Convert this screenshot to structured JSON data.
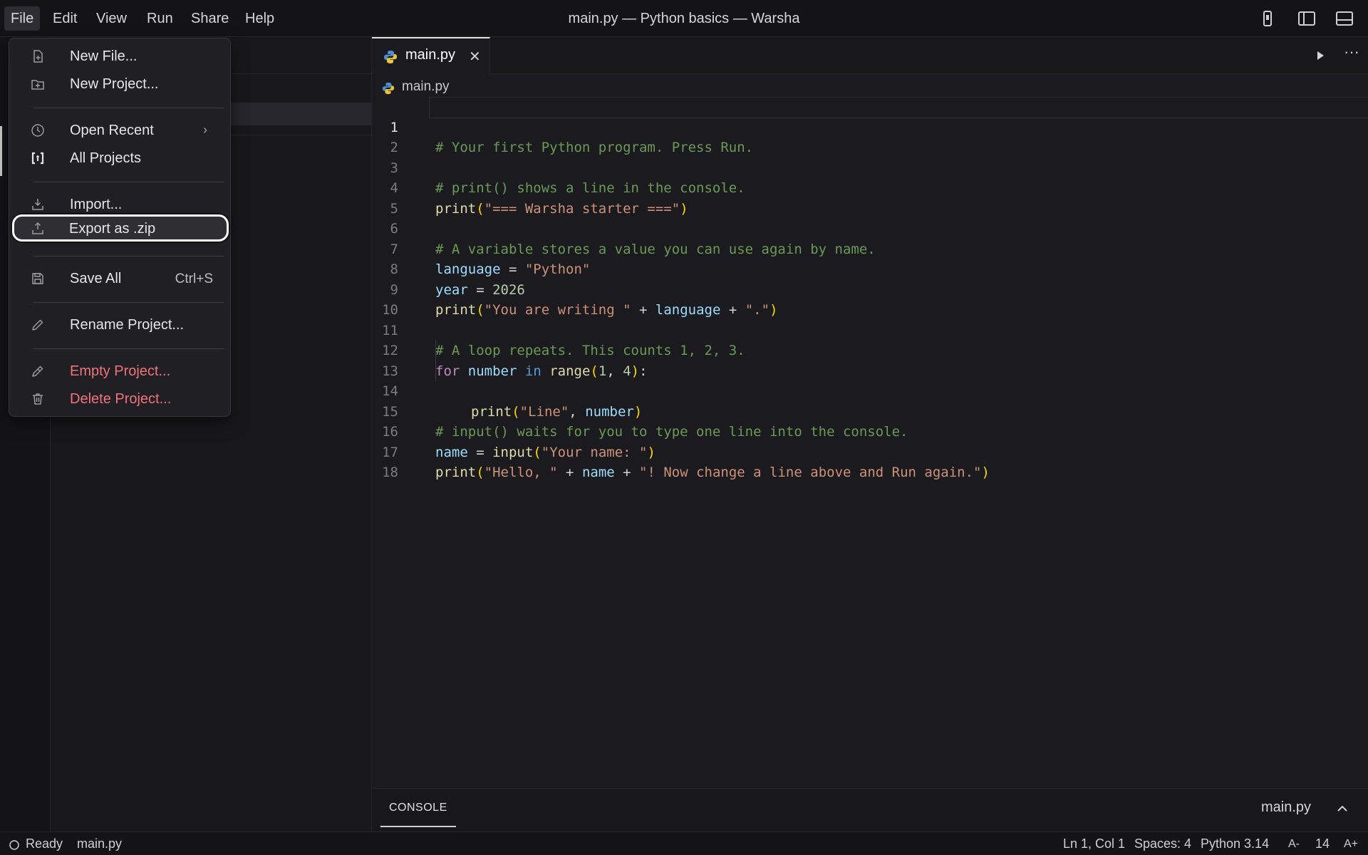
{
  "menubar": {
    "items": [
      "File",
      "Edit",
      "View",
      "Run",
      "Share",
      "Help"
    ],
    "window_title": "main.py — Python basics — Warsha"
  },
  "file_menu": {
    "new_file": "New File...",
    "new_project": "New Project...",
    "open_recent": "Open Recent",
    "all_projects": "All Projects",
    "import": "Import...",
    "export_zip": "Export as .zip",
    "save_all": "Save All",
    "save_all_shortcut": "Ctrl+S",
    "rename_project": "Rename Project...",
    "empty_project": "Empty Project...",
    "delete_project": "Delete Project..."
  },
  "editor": {
    "tab_label": "main.py",
    "breadcrumb": "main.py",
    "more_label": "···",
    "line_numbers": [
      "1",
      "2",
      "3",
      "4",
      "5",
      "6",
      "7",
      "8",
      "9",
      "10",
      "11",
      "12",
      "13",
      "14",
      "15",
      "16",
      "17",
      "18"
    ],
    "code": {
      "l1": "# Your first Python program. Press Run.",
      "l3": "# print() shows a line in the console.",
      "l4_fn": "print",
      "l4_str": "\"=== Warsha starter ===\"",
      "l6": "# A variable stores a value you can use again by name.",
      "l7_var": "language",
      "l7_op": " = ",
      "l7_str": "\"Python\"",
      "l8_var": "year",
      "l8_op": " = ",
      "l8_num": "2026",
      "l9_fn": "print",
      "l9_str1": "\"You are writing \"",
      "l9_op1": " + ",
      "l9_var": "language",
      "l9_op2": " + ",
      "l9_str2": "\".\"",
      "l11": "# A loop repeats. This counts 1, 2, 3.",
      "l12_kw": "for",
      "l12_var": "number",
      "l12_in": "in",
      "l12_fn": "range",
      "l12_n1": "1",
      "l12_comma": ", ",
      "l12_n2": "4",
      "l12_colon": ":",
      "l13_fn": "print",
      "l13_str": "\"Line\"",
      "l13_comma": ", ",
      "l13_var": "number",
      "l15": "# input() waits for you to type one line into the console.",
      "l16_var": "name",
      "l16_op": " = ",
      "l16_fn": "input",
      "l16_str": "\"Your name: \"",
      "l17_fn": "print",
      "l17_str1": "\"Hello, \"",
      "l17_op1": " + ",
      "l17_var": "name",
      "l17_op2": " + ",
      "l17_str2": "\"! Now change a line above and Run again.\""
    }
  },
  "console": {
    "tab_label": "CONSOLE",
    "file_label": "main.py"
  },
  "status_bar": {
    "status": "Ready",
    "file": "main.py",
    "cursor": "Ln 1, Col 1",
    "spaces": "Spaces: 4",
    "language": "Python 3.14",
    "font_decrease": "A-",
    "font_size": "14",
    "font_increase": "A+"
  },
  "colors": {
    "comment": "#6a9955",
    "function": "#dcdcaa",
    "string": "#ce9178",
    "variable": "#9cdcfe",
    "danger": "#f0727a",
    "background": "#1b1b1f"
  },
  "icons": {
    "new_file": "file-plus-icon",
    "new_project": "folder-plus-icon",
    "open_recent": "clock-icon",
    "all_projects": "brackets-icon",
    "import": "import-icon",
    "export": "export-icon",
    "save_all": "save-icon",
    "rename": "pencil-icon",
    "empty": "eraser-icon",
    "delete": "trash-icon"
  }
}
